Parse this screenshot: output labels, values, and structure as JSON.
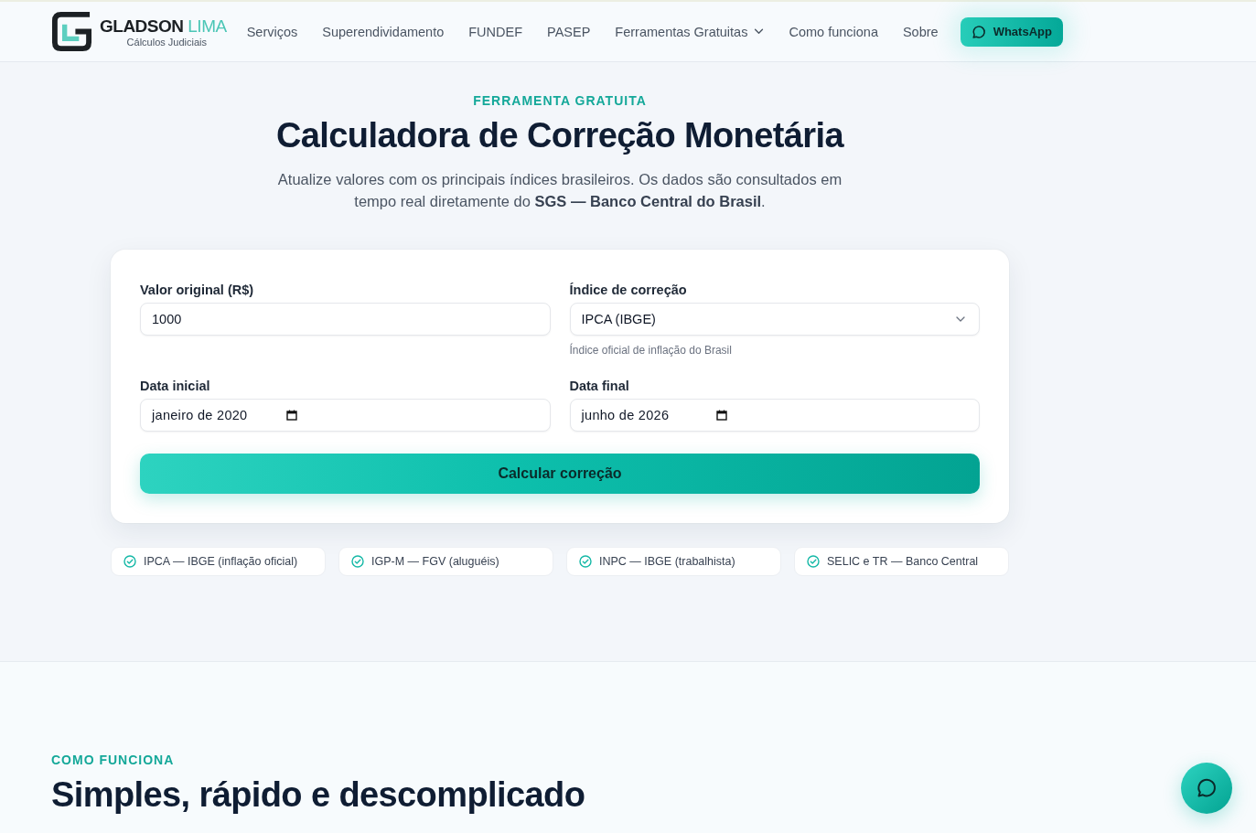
{
  "header": {
    "brand": {
      "name": "GLADSON",
      "name_accent": "LIMA",
      "tagline": "Cálculos Judiciais"
    },
    "nav": [
      {
        "label": "Serviços",
        "kind": "link"
      },
      {
        "label": "Superendividamento",
        "kind": "link"
      },
      {
        "label": "FUNDEF",
        "kind": "link"
      },
      {
        "label": "PASEP",
        "kind": "link"
      },
      {
        "label": "Ferramentas Gratuitas",
        "kind": "dropdown"
      },
      {
        "label": "Como funciona",
        "kind": "link"
      },
      {
        "label": "Sobre",
        "kind": "link"
      }
    ],
    "cta": {
      "label": "WhatsApp"
    }
  },
  "hero": {
    "eyebrow": "FERRAMENTA GRATUITA",
    "title": "Calculadora de Correção Monetária",
    "intro": "Atualize valores com os principais índices brasileiros. Os dados são consultados em tempo real diretamente do **SGS — Banco Central do Brasil**."
  },
  "form": {
    "fields": [
      {
        "label": "Valor original (R$)",
        "kind": "text",
        "value": "1000"
      },
      {
        "label": "Índice de correção",
        "kind": "select",
        "value": "IPCA (IBGE)",
        "hint": "Índice oficial de inflação do Brasil"
      },
      {
        "label": "Data inicial",
        "kind": "month",
        "value": "janeiro de 2020"
      },
      {
        "label": "Data final",
        "kind": "month",
        "value": "junho de 2026"
      }
    ],
    "submit": "Calcular correção"
  },
  "indices": [
    "IPCA — IBGE (inflação oficial)",
    "IGP-M — FGV (aluguéis)",
    "INPC — IBGE (trabalhista)",
    "SELIC e TR — Banco Central"
  ],
  "how_it_works": {
    "eyebrow": "COMO FUNCIONA",
    "title": "Simples, rápido e descomplicado"
  }
}
